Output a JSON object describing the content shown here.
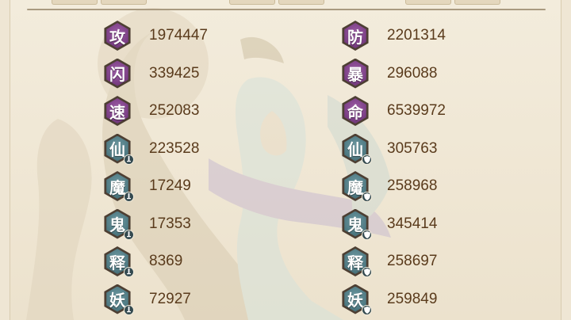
{
  "stats": {
    "left": [
      {
        "glyph": "攻",
        "value": "1974447",
        "color": "purple",
        "badge_icon": ""
      },
      {
        "glyph": "闪",
        "value": "339425",
        "color": "purple",
        "badge_icon": ""
      },
      {
        "glyph": "速",
        "value": "252083",
        "color": "purple",
        "badge_icon": ""
      },
      {
        "glyph": "仙",
        "value": "223528",
        "color": "teal",
        "badge_icon": "sword-icon"
      },
      {
        "glyph": "魔",
        "value": "17249",
        "color": "teal",
        "badge_icon": "sword-icon"
      },
      {
        "glyph": "鬼",
        "value": "17353",
        "color": "teal",
        "badge_icon": "sword-icon"
      },
      {
        "glyph": "释",
        "value": "8369",
        "color": "teal",
        "badge_icon": "sword-icon"
      },
      {
        "glyph": "妖",
        "value": "72927",
        "color": "teal",
        "badge_icon": "sword-icon"
      }
    ],
    "right": [
      {
        "glyph": "防",
        "value": "2201314",
        "color": "purple",
        "badge_icon": ""
      },
      {
        "glyph": "暴",
        "value": "296088",
        "color": "purple",
        "badge_icon": ""
      },
      {
        "glyph": "命",
        "value": "6539972",
        "color": "purple",
        "badge_icon": ""
      },
      {
        "glyph": "仙",
        "value": "305763",
        "color": "teal",
        "badge_icon": "shield-icon"
      },
      {
        "glyph": "魔",
        "value": "258968",
        "color": "teal",
        "badge_icon": "shield-icon"
      },
      {
        "glyph": "鬼",
        "value": "345414",
        "color": "teal",
        "badge_icon": "shield-icon"
      },
      {
        "glyph": "释",
        "value": "258697",
        "color": "teal",
        "badge_icon": "shield-icon"
      },
      {
        "glyph": "妖",
        "value": "259849",
        "color": "teal",
        "badge_icon": "shield-icon"
      }
    ]
  },
  "colors": {
    "purple_icon": "#7c3f86",
    "teal_icon": "#4f7a83",
    "value_text": "#5a3b1c",
    "panel_bg": "#efe6d4",
    "divider": "#a99a80"
  }
}
